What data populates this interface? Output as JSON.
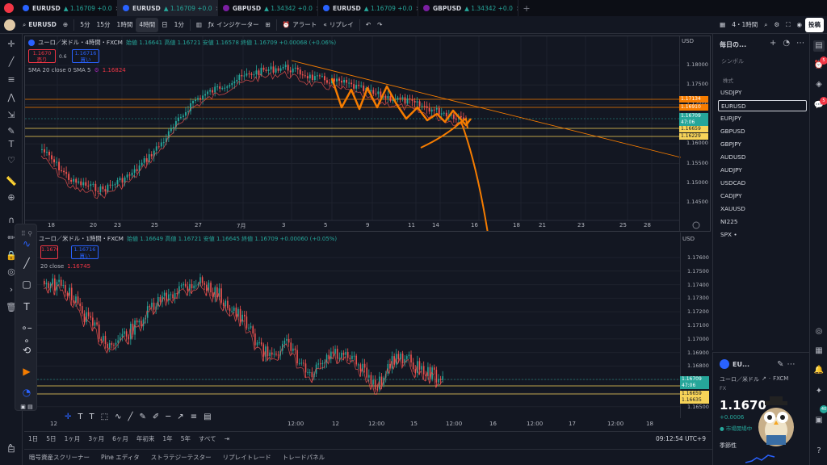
{
  "tabs": [
    {
      "symbol": "EURUSD",
      "price": "▲ 1.16709 +0.0"
    },
    {
      "symbol": "EURUSD",
      "price": "▲ 1.16709 +0.0"
    },
    {
      "symbol": "GBPUSD",
      "price": "▲ 1.34342 +0.0"
    },
    {
      "symbol": "EURUSD",
      "price": "▲ 1.16709 +0.0"
    },
    {
      "symbol": "GBPUSD",
      "price": "▲ 1.34342 +0.0"
    }
  ],
  "toolbar": {
    "symbol": "EURUSD",
    "intervals": [
      "5分",
      "15分",
      "1時間",
      "4時間",
      "日",
      "1分"
    ],
    "indicators": "インジケーター",
    "alert": "アラート",
    "replay": "リプレイ",
    "layout": "4・1時間",
    "publish": "投稿"
  },
  "pane1": {
    "title": "ユーロ／米ドル・4時間・FXCM",
    "ohlc": "始値 1.16641 高値 1.16721 安値 1.16578 終値 1.16709 +0.00068 (+0.06%)",
    "sell_price": "1.1670",
    "sell_label": "売り",
    "spread": "0.6",
    "buy_price": "1.16716",
    "buy_label": "買い",
    "ma_label": "SMA 20 close 0 SMA 5",
    "ma_value": "1.16824",
    "currency": "USD",
    "prices": [
      "1.18000",
      "1.17500",
      "1.17000",
      "1.16500",
      "1.16000",
      "1.15500",
      "1.15000",
      "1.14500"
    ],
    "tags": [
      {
        "v": "1.17134",
        "c": "#f57c00"
      },
      {
        "v": "1.16910",
        "c": "#f57c00"
      },
      {
        "v": "1.16709",
        "c": "#26a69a"
      },
      {
        "v": "47:06",
        "c": "#26a69a"
      },
      {
        "v": "1.16659",
        "c": "#f7d358"
      },
      {
        "v": "1.16229",
        "c": "#f7d358"
      }
    ],
    "dates": [
      "18",
      "20",
      "23",
      "25",
      "27",
      "7月",
      "3",
      "5",
      "9",
      "11",
      "14",
      "16",
      "18",
      "21",
      "23",
      "25",
      "28"
    ]
  },
  "pane2": {
    "title": "ユーロ／米ドル・1時間・FXCM",
    "ohlc": "始値 1.16649 高値 1.16721 安値 1.16645 終値 1.16709 +0.00060 (+0.05%)",
    "sell_price": "1.1670",
    "buy_price": "1.16716",
    "buy_label": "買い",
    "ma_label": "20 close",
    "ma_value": "1.16745",
    "currency": "USD",
    "prices": [
      "1.17600",
      "1.17500",
      "1.17400",
      "1.17300",
      "1.17200",
      "1.17100",
      "1.17000",
      "1.16900",
      "1.16800",
      "1.16700",
      "1.16600",
      "1.16500"
    ],
    "tags": [
      {
        "v": "1.16709",
        "c": "#26a69a"
      },
      {
        "v": "47:06",
        "c": "#26a69a"
      },
      {
        "v": "1.16659",
        "c": "#f7d358"
      },
      {
        "v": "1.16635",
        "c": "#f7d358"
      }
    ],
    "dates": [
      "12",
      "12:00",
      "12",
      "12:00",
      "15",
      "12:00",
      "16",
      "12:00",
      "17",
      "12:00",
      "18"
    ]
  },
  "bottombar": {
    "ranges": [
      "1日",
      "5日",
      "1ヶ月",
      "3ヶ月",
      "6ヶ月",
      "年初来",
      "1年",
      "5年",
      "すべて"
    ],
    "clock": "09:12:54 UTC+9"
  },
  "bottomtabs": [
    "暗号資産スクリーナー",
    "Pine エディタ",
    "ストラテジーテスター",
    "リプレイトレード",
    "トレードパネル"
  ],
  "watchlist": {
    "title": "毎日の...",
    "col": "シンボル",
    "section": "株式",
    "items": [
      "USDJPY",
      "EURUSD",
      "EURJPY",
      "GBPUSD",
      "GBPJPY",
      "AUDUSD",
      "AUDJPY",
      "USDCAD",
      "CADJPY",
      "XAUUSD",
      "NI225",
      "SPX •"
    ]
  },
  "symbolpanel": {
    "symbol": "EU...",
    "name": "ユーロ／米ドル",
    "source": "FXCM",
    "type": "FX",
    "price": "1.1670",
    "change": "+0.0006",
    "status": "市場開場中",
    "season": "季節性"
  }
}
